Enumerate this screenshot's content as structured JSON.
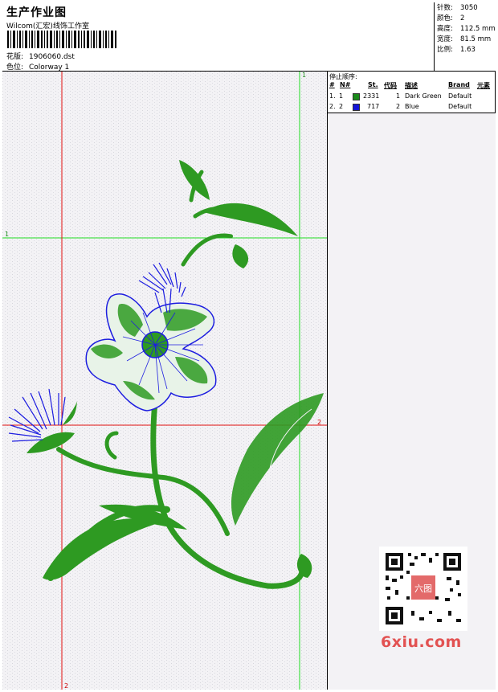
{
  "header": {
    "title": "生产作业图",
    "studio": "Wilcom(汇宏)线饰工作室",
    "design_label": "花版:",
    "design_file": "1906060.dst",
    "color_label": "色位:",
    "colorway": "Colorway 1"
  },
  "stats": [
    {
      "label": "针数:",
      "value": "3050"
    },
    {
      "label": "颜色:",
      "value": "2"
    },
    {
      "label": "高度:",
      "value": "112.5 mm"
    },
    {
      "label": "宽度:",
      "value": "81.5 mm"
    },
    {
      "label": "比例:",
      "value": "1.63"
    }
  ],
  "stops": {
    "caption": "停止顺序:",
    "columns": [
      "#",
      "N#",
      "St.",
      "代码",
      "描述",
      "Brand",
      "元素"
    ],
    "rows": [
      {
        "idx": "1.",
        "n": "1",
        "color": "#1a8a1a",
        "st": "2331",
        "code": "1",
        "desc": "Dark Green",
        "brand": "Default"
      },
      {
        "idx": "2.",
        "n": "2",
        "color": "#1414d8",
        "st": "717",
        "code": "2",
        "desc": "Blue",
        "brand": "Default"
      }
    ]
  },
  "guides": {
    "green_v_top": "1",
    "green_h_left": "1",
    "red_h_right": "2",
    "red_v_bottom": "2"
  },
  "colors": {
    "thread_green": "#2e9a22",
    "thread_blue": "#1d1de0",
    "guide_green": "#22dd22",
    "guide_red": "#e01010"
  },
  "watermark": {
    "text": "6xiu.com",
    "qr_label": "六图"
  }
}
